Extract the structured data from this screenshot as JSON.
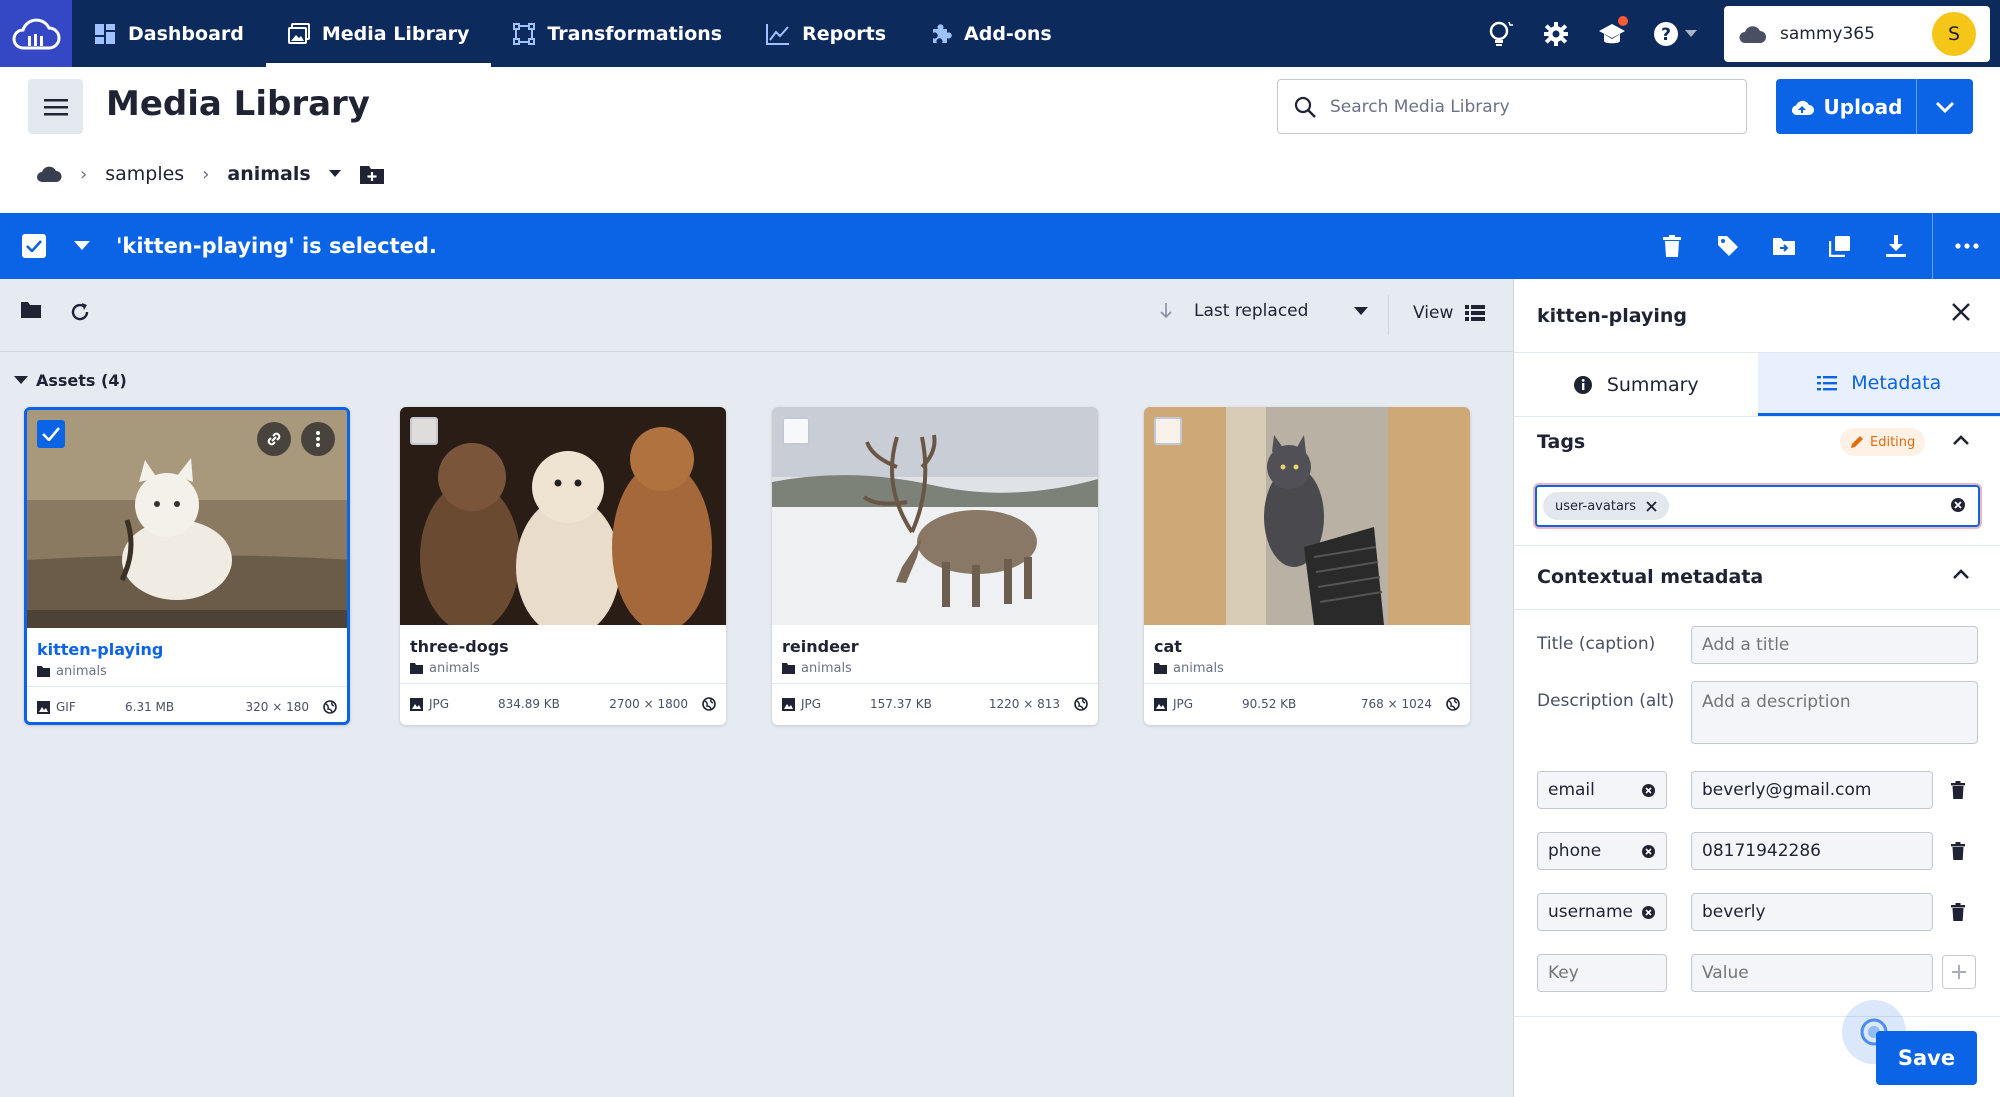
{
  "nav": {
    "items": [
      {
        "label": "Dashboard",
        "icon": "dashboard-icon"
      },
      {
        "label": "Media Library",
        "icon": "media-library-icon",
        "active": true
      },
      {
        "label": "Transformations",
        "icon": "transformations-icon"
      },
      {
        "label": "Reports",
        "icon": "reports-icon"
      },
      {
        "label": "Add-ons",
        "icon": "puzzle-icon"
      }
    ],
    "account": {
      "name": "sammy365",
      "initial": "S"
    }
  },
  "header": {
    "title": "Media Library",
    "search_placeholder": "Search Media Library",
    "upload_label": "Upload"
  },
  "breadcrumb": {
    "items": [
      "samples",
      "animals"
    ]
  },
  "selection": {
    "text": "'kitten-playing' is selected."
  },
  "toolbar": {
    "sort_label": "Last replaced",
    "view_label": "View"
  },
  "assets": {
    "header": "Assets (4)",
    "items": [
      {
        "name": "kitten-playing",
        "folder": "animals",
        "format": "GIF",
        "size": "6.31 MB",
        "dimensions": "320 × 180",
        "selected": true
      },
      {
        "name": "three-dogs",
        "folder": "animals",
        "format": "JPG",
        "size": "834.89 KB",
        "dimensions": "2700 × 1800",
        "selected": false
      },
      {
        "name": "reindeer",
        "folder": "animals",
        "format": "JPG",
        "size": "157.37 KB",
        "dimensions": "1220 × 813",
        "selected": false
      },
      {
        "name": "cat",
        "folder": "animals",
        "format": "JPG",
        "size": "90.52 KB",
        "dimensions": "768 × 1024",
        "selected": false
      }
    ]
  },
  "panel": {
    "title": "kitten-playing",
    "tabs": [
      {
        "label": "Summary"
      },
      {
        "label": "Metadata",
        "active": true
      }
    ],
    "tags": {
      "header": "Tags",
      "editing_label": "Editing",
      "chips": [
        "user-avatars"
      ]
    },
    "contextual": {
      "header": "Contextual metadata",
      "title_label": "Title (caption)",
      "title_placeholder": "Add a title",
      "description_label": "Description (alt)",
      "description_placeholder": "Add a description",
      "pairs": [
        {
          "key": "email",
          "value": "beverly@gmail.com"
        },
        {
          "key": "phone",
          "value": "08171942286"
        },
        {
          "key": "username",
          "value": "beverly"
        }
      ],
      "key_placeholder": "Key",
      "value_placeholder": "Value"
    },
    "save_label": "Save"
  },
  "colors": {
    "navy": "#0d2a5c",
    "accent": "#0b63e5",
    "logo": "#3448c5"
  }
}
